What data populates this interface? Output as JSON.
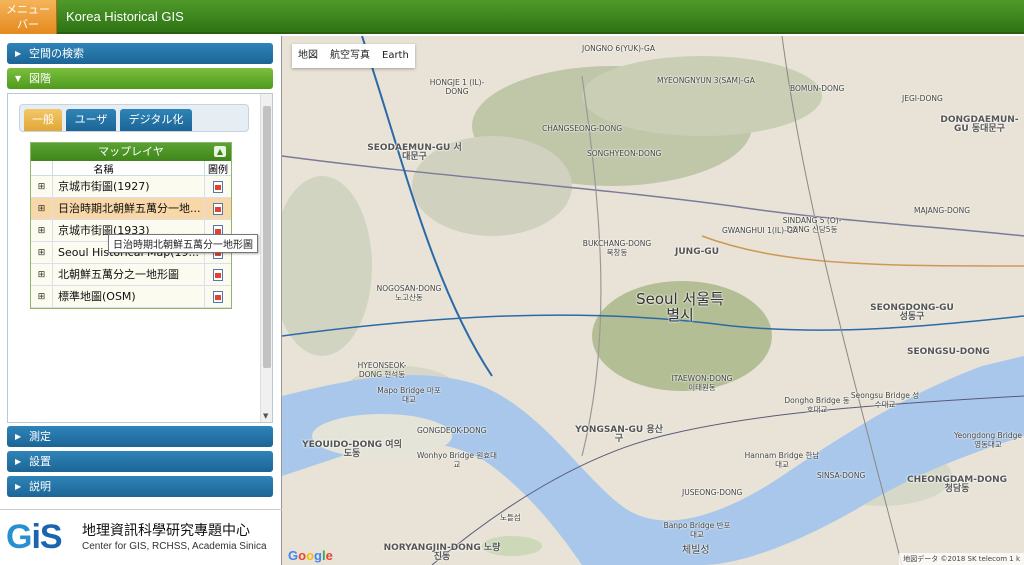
{
  "topbar": {
    "menu_label": "メニューバー",
    "title": "Korea Historical GIS"
  },
  "sidebar": {
    "sections": [
      {
        "label": "空間の検索"
      },
      {
        "label": "図階"
      },
      {
        "label": "測定"
      },
      {
        "label": "設置"
      },
      {
        "label": "説明"
      }
    ],
    "tabs": [
      "一般",
      "ユーザ",
      "デジタル化"
    ],
    "layer_panel": {
      "title": "マップレイヤ",
      "col_name": "名稱",
      "col_legend": "圖例",
      "layers": [
        "京城市街圖(1927)",
        "日治時期北朝鮮五萬分一地...",
        "京城市街圖(1933)",
        "Seoul Historical Map(19...",
        "北朝鮮五萬分之一地形圖",
        "標準地圖(OSM)"
      ]
    },
    "tooltip": "日治時期北朝鮮五萬分一地形圖",
    "logo": {
      "mark": "GIS",
      "center_cn": "地理資訊科學研究專題中心",
      "center_en": "Center for GIS, RCHSS, Academia Sinica"
    }
  },
  "map": {
    "types": [
      "地図",
      "航空写真",
      "Earth"
    ],
    "attribution": "地図データ ©2018 SK telecom   1 k",
    "google": "Google",
    "labels": [
      "JONGNO 6(YUK)-GA",
      "HONGJE 1 (IL)-DONG",
      "MYEONGNYUN 3(SAM)-GA",
      "SEODAEMUN-GU 서대문구",
      "CHANGSEONG-DONG",
      "SONGHYEON-DONG",
      "DONGDAEMUN-GU 동대문구",
      "JEGI-DONG",
      "BOMUN-DONG",
      "MAJANG-DONG",
      "JUNG-GU",
      "Seoul 서울특별시",
      "SEONGDONG-GU 성동구",
      "SEONGSU-DONG",
      "YONGSAN-GU 용산구",
      "ITAEWON-DONG 이태원동",
      "Mapo Bridge 마포대교",
      "YEOUIDO-DONG 여의도동",
      "Wonhyo Bridge 원효대교",
      "Hannam Bridge 한남대교",
      "Dongho Bridge 동호대교",
      "Seongsu Bridge 성수대교",
      "Yeongdong Bridge 영동대교",
      "CHEONGDAM-DONG 청담동",
      "NORYANGJIN-DONG 노량진동",
      "Banpo Bridge 반포대교",
      "노들섬",
      "체빌성",
      "HYEONSEOK-DONG 현석동",
      "JUSEONG-DONG",
      "NOGOSAN-DONG 노고산동",
      "GONGDEOK-DONG",
      "SINDANG 5 (O)-DONG 신당5동",
      "GWANGHUI 1(IL)-GA",
      "SINSA-DONG",
      "BUKCHANG-DONG 북창동"
    ]
  }
}
